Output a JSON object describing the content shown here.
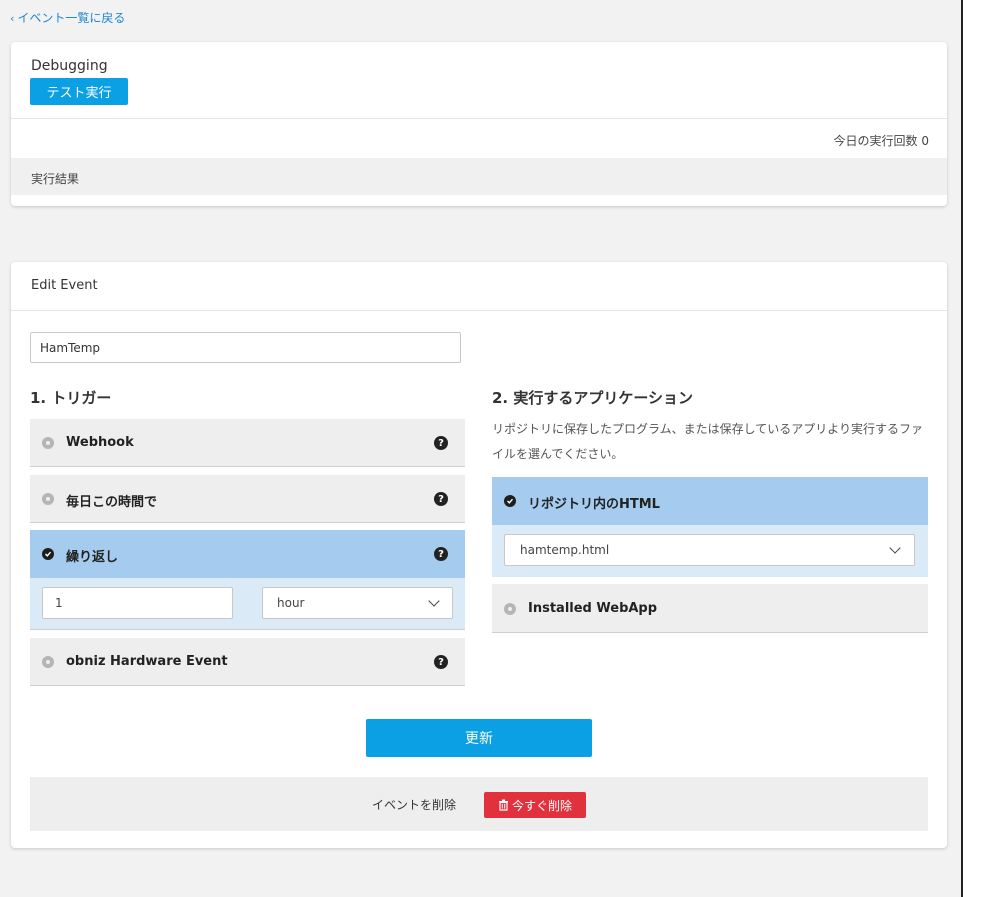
{
  "nav": {
    "back_label": "イベント一覧に戻る"
  },
  "debug": {
    "title": "Debugging",
    "test_button": "テスト実行",
    "run_count": "今日の実行回数 0",
    "result_label": "実行結果"
  },
  "edit": {
    "title": "Edit Event",
    "event_name": "HamTemp",
    "trigger": {
      "title": "1. トリガー",
      "options": [
        {
          "label": "Webhook",
          "help": "?",
          "selected": false
        },
        {
          "label": "毎日この時間で",
          "help": "?",
          "selected": false
        },
        {
          "label": "繰り返し",
          "help": "?",
          "selected": true
        },
        {
          "label": "obniz Hardware Event",
          "help": "?",
          "selected": false
        }
      ],
      "repeat_value": "1",
      "repeat_unit": "hour"
    },
    "app": {
      "title": "2. 実行するアプリケーション",
      "description": "リポジトリに保存したプログラム、または保存しているアプリより実行するファイルを選んでください。",
      "options": [
        {
          "label": "リポジトリ内のHTML",
          "selected": true
        },
        {
          "label": "Installed WebApp",
          "selected": false
        }
      ],
      "selected_file": "hamtemp.html"
    },
    "update_button": "更新",
    "delete_label": "イベントを削除",
    "delete_button": "今すぐ削除"
  },
  "colors": {
    "accent": "#0aa0e3",
    "danger": "#e0313d",
    "selected_bg": "#a5ccee",
    "selected_panel_bg": "#daeaf7"
  }
}
